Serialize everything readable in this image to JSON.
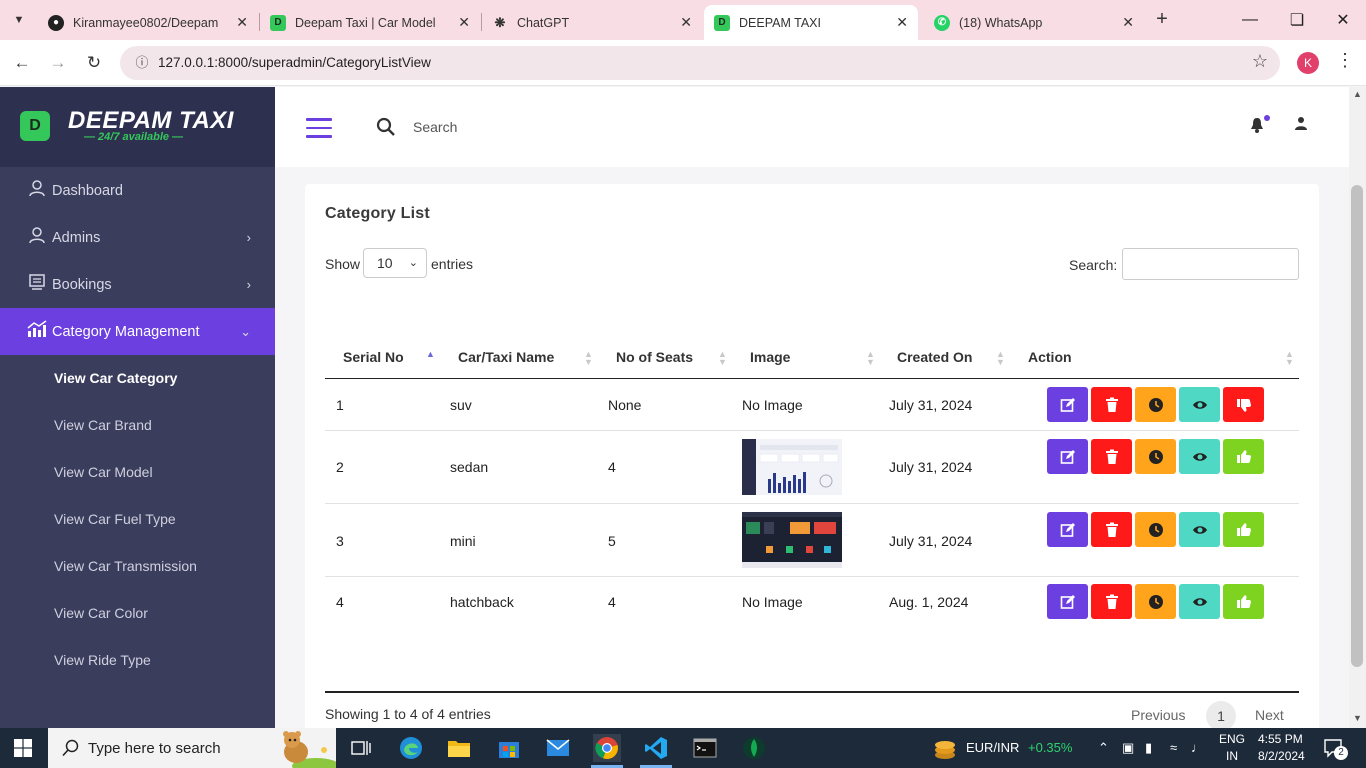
{
  "browser": {
    "tabs": [
      {
        "title": "Kiranmayee0802/Deepam",
        "icon": "github-icon",
        "active": false
      },
      {
        "title": "Deepam Taxi | Car Model",
        "icon": "deepam-favicon",
        "active": false
      },
      {
        "title": "ChatGPT",
        "icon": "chatgpt-icon",
        "active": false
      },
      {
        "title": "DEEPAM TAXI",
        "icon": "deepam-favicon",
        "active": true
      },
      {
        "title": "(18) WhatsApp",
        "icon": "whatsapp-icon",
        "active": false
      }
    ],
    "url": "127.0.0.1:8000/superadmin/CategoryListView",
    "profile_initial": "K"
  },
  "brand": {
    "name": "DEEPAM TAXI",
    "tagline": "— 24/7 available —",
    "logo_letter": "D",
    "accent": "#34c759"
  },
  "sidebar": {
    "items": [
      {
        "label": "Dashboard",
        "icon": "user-icon"
      },
      {
        "label": "Admins",
        "icon": "user-icon"
      },
      {
        "label": "Bookings",
        "icon": "list-icon"
      },
      {
        "label": "Category Management",
        "icon": "chart-icon"
      }
    ],
    "subitems": [
      {
        "label": "View Car Category"
      },
      {
        "label": "View Car Brand"
      },
      {
        "label": "View Car Model"
      },
      {
        "label": "View Car Fuel Type"
      },
      {
        "label": "View Car Transmission"
      },
      {
        "label": "View Car Color"
      },
      {
        "label": "View Ride Type"
      }
    ]
  },
  "header": {
    "search_label": "Search"
  },
  "card": {
    "title": "Category List",
    "length_prefix": "Show",
    "length_value": "10",
    "length_suffix": "entries",
    "filter_label": "Search:",
    "info": "Showing 1 to 4 of 4 entries",
    "prev": "Previous",
    "page": "1",
    "next": "Next"
  },
  "table": {
    "columns": [
      "Serial No",
      "Car/Taxi Name",
      "No of Seats",
      "Image",
      "Created On",
      "Action"
    ],
    "rows": [
      {
        "serial": "1",
        "name": "suv",
        "seats": "None",
        "image": "No Image",
        "created": "July 31, 2024",
        "approval": "dislike"
      },
      {
        "serial": "2",
        "name": "sedan",
        "seats": "4",
        "image": "",
        "created": "July 31, 2024",
        "approval": "like"
      },
      {
        "serial": "3",
        "name": "mini",
        "seats": "5",
        "image": "",
        "created": "July 31, 2024",
        "approval": "like"
      },
      {
        "serial": "4",
        "name": "hatchback",
        "seats": "4",
        "image": "No Image",
        "created": "Aug. 1, 2024",
        "approval": "like"
      }
    ]
  },
  "colors": {
    "primary": "#6b3fe0",
    "danger": "#ff1a1a",
    "warning": "#ffa41b",
    "info": "#4fd9c4",
    "success": "#7ed321",
    "sidebar_bg": "#3b3d5c"
  },
  "taskbar": {
    "search_placeholder": "Type here to search",
    "currency_pair": "EUR/INR",
    "currency_change": "+0.35%",
    "lang_top": "ENG",
    "lang_bottom": "IN",
    "time": "4:55 PM",
    "date": "8/2/2024",
    "notification_count": "2"
  }
}
